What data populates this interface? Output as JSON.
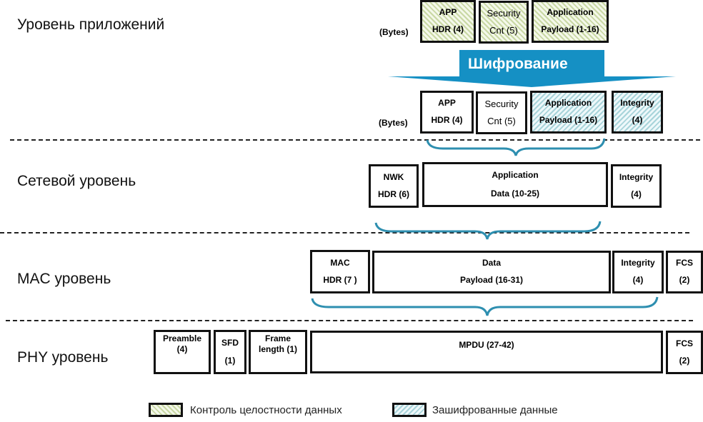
{
  "layers": {
    "app": "Уровень приложений",
    "nwk": "Сетевой уровень",
    "mac": "MAC уровень",
    "phy": "PHY уровень"
  },
  "bytes_label": "(Bytes)",
  "encryption_label": "Шифрование",
  "colors": {
    "accent_blue": "#1590c4",
    "brace": "#2e8fb0",
    "integrity_hatch": "#c9d8a4",
    "encrypted_hatch": "#a8d4da"
  },
  "app_before": [
    {
      "line1": "APP",
      "line2": "HDR (4)",
      "fill": "integrity"
    },
    {
      "line1": "Security",
      "line2": "Cnt (5)",
      "fill": "integrity"
    },
    {
      "line1": "Application",
      "line2": "Payload (1-16)",
      "fill": "integrity"
    }
  ],
  "app_after": [
    {
      "line1": "APP",
      "line2": "HDR (4)",
      "fill": "none"
    },
    {
      "line1": "Security",
      "line2": "Cnt (5)",
      "fill": "none"
    },
    {
      "line1": "Application",
      "line2": "Payload (1-16)",
      "fill": "encrypted"
    },
    {
      "line1": "Integrity",
      "line2": "(4)",
      "fill": "encrypted"
    }
  ],
  "nwk": [
    {
      "line1": "NWK",
      "line2": "HDR (6)"
    },
    {
      "line1": "Application",
      "line2": "Data (10-25)"
    },
    {
      "line1": "Integrity",
      "line2": "(4)"
    }
  ],
  "mac": [
    {
      "line1": "MAC",
      "line2": "HDR (7 )"
    },
    {
      "line1": "Data",
      "line2": "Payload (16-31)"
    },
    {
      "line1": "Integrity",
      "line2": "(4)"
    },
    {
      "line1": "FCS",
      "line2": "(2)"
    }
  ],
  "phy": [
    {
      "line1": "Preamble",
      "line2": "(4)"
    },
    {
      "line1": "SFD",
      "line2": "(1)"
    },
    {
      "line1": "Frame",
      "line2": "length (1)"
    },
    {
      "line1": "MPDU (27-42)",
      "line2": ""
    },
    {
      "line1": "FCS",
      "line2": "(2)"
    }
  ],
  "legend": {
    "integrity": "Контроль целостности данных",
    "encrypted": "Зашифрованные данные"
  }
}
